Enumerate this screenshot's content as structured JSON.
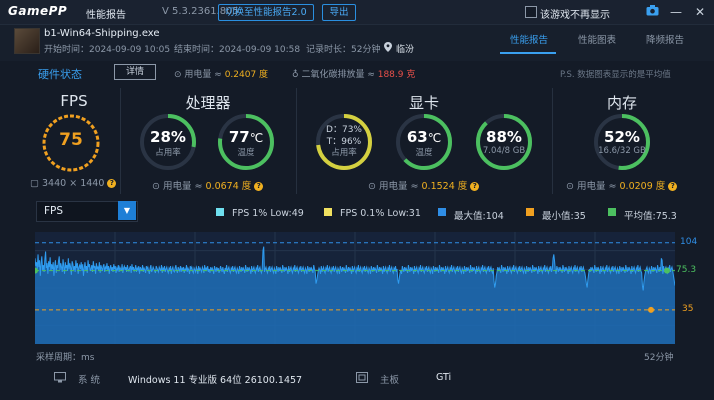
{
  "titlebar": {
    "logo": "GamePP",
    "title": "性能报告",
    "version": "V 5.3.2361.805",
    "switch_btn": "切换至性能报告2.0",
    "export_btn": "导出",
    "no_show_label": "该游戏不再显示"
  },
  "game": {
    "exe": "b1-Win64-Shipping.exe",
    "start": "开始时间：2024-09-09 10:05",
    "end": "结束时间：2024-09-09 10:58",
    "duration": "记录时长：52分钟",
    "location": "临汾"
  },
  "tabs": [
    {
      "label": "性能报告",
      "active": true
    },
    {
      "label": "性能图表",
      "active": false
    },
    {
      "label": "降频报告",
      "active": false
    }
  ],
  "status_row": {
    "title": "硬件状态",
    "detail_btn": "详情",
    "power_label": "用电量 ≈ ",
    "power_value": "0.2407 度",
    "co2_label": "二氧化碳排放量 ≈ ",
    "co2_value": "188.9 克",
    "ps": "P.S. 数据图表显示的是平均值"
  },
  "cards": {
    "fps": {
      "title": "FPS",
      "value": "75",
      "resolution": "3440 × 1440"
    },
    "cpu": {
      "title": "处理器",
      "usage": "28%",
      "usage_label": "占用率",
      "usage_pct": 28,
      "temp": "77",
      "temp_unit": "℃",
      "temp_label": "温度",
      "temp_pct": 77,
      "power_label": "用电量 ≈ ",
      "power_value": "0.0674 度"
    },
    "gpu": {
      "title": "显卡",
      "d_line": "D：73%",
      "t_line": "T：96%",
      "usage_label": "占用率",
      "usage_pct": 73,
      "temp": "63",
      "temp_unit": "℃",
      "temp_label": "温度",
      "temp_pct": 63,
      "vram": "88%",
      "vram_sub": "7.04/8 GB",
      "vram_pct": 88,
      "power_label": "用电量 ≈ ",
      "power_value": "0.1524 度"
    },
    "mem": {
      "title": "内存",
      "usage": "52%",
      "usage_sub": "16.6/32 GB",
      "usage_pct": 52,
      "power_label": "用电量 ≈ ",
      "power_value": "0.0209 度"
    }
  },
  "chart_controls": {
    "select_value": "FPS",
    "legend": [
      {
        "label": "FPS 1% Low:49",
        "color": "#6fe0f0"
      },
      {
        "label": "FPS 0.1% Low:31",
        "color": "#f0e060"
      },
      {
        "label": "最大值:104",
        "color": "#2f8ee6"
      },
      {
        "label": "最小值:35",
        "color": "#f0a020"
      },
      {
        "label": "平均值:75.3",
        "color": "#4cc060"
      }
    ]
  },
  "chart_data": {
    "type": "area",
    "series": [
      {
        "values": [
          88,
          80,
          84,
          77,
          92,
          79,
          86,
          70,
          83,
          90,
          76,
          81,
          74,
          87,
          95,
          78,
          83,
          72,
          85,
          79,
          89,
          75,
          82,
          77,
          84,
          70,
          80,
          86,
          73,
          81,
          78,
          85,
          90,
          76,
          83,
          79,
          74,
          87,
          80,
          72,
          84,
          78,
          81,
          75,
          88,
          77,
          83,
          79,
          71,
          85,
          82,
          76,
          80,
          74,
          86,
          78,
          83,
          72,
          79,
          81,
          77,
          84,
          75,
          82,
          70,
          78,
          84,
          76,
          80,
          73,
          86,
          79,
          82,
          75,
          77,
          81,
          74,
          85,
          78,
          80,
          72,
          83,
          77,
          79,
          76,
          84,
          73,
          81,
          78,
          75,
          80,
          82,
          74,
          79,
          77,
          83,
          76,
          80,
          72,
          78,
          81,
          75,
          79,
          74,
          82,
          77,
          80,
          73,
          78,
          76,
          81,
          74,
          79,
          77,
          75,
          82,
          73,
          78,
          80,
          76,
          79,
          74,
          81,
          77,
          75,
          78,
          80,
          73,
          82,
          76,
          79,
          75,
          77,
          81,
          74,
          78,
          76,
          80,
          72,
          79,
          77,
          75,
          81,
          74,
          78,
          76,
          73,
          80,
          77,
          79,
          75,
          72,
          78,
          81,
          74,
          76,
          79,
          77,
          75,
          73,
          80,
          78,
          76,
          74,
          79,
          77,
          75,
          81,
          73,
          78,
          76,
          80,
          74,
          77,
          79,
          75,
          73,
          78,
          76,
          80,
          72,
          77,
          79,
          75,
          74,
          78,
          81,
          76,
          73,
          79,
          77,
          75,
          80,
          74,
          78,
          76,
          79,
          73,
          77,
          75,
          81,
          74,
          78,
          76,
          72,
          80,
          77,
          79,
          75,
          73,
          78,
          76,
          74,
          79,
          77,
          72,
          80,
          75,
          78,
          76,
          74,
          79,
          77,
          73,
          81,
          75,
          78,
          76,
          80,
          74,
          77,
          73,
          79,
          75,
          78,
          76,
          72,
          80,
          77,
          74,
          79,
          75,
          78,
          73,
          76,
          80,
          77,
          74,
          79,
          75,
          72,
          78,
          76,
          81,
          74,
          77,
          79,
          75,
          73,
          78,
          76,
          80,
          74,
          77,
          79,
          75,
          73,
          78,
          76,
          72,
          80,
          77,
          74,
          79,
          75,
          78,
          76,
          73,
          81,
          77,
          74,
          79,
          75,
          78,
          76,
          72,
          80,
          74,
          77,
          79,
          75,
          73,
          78,
          76,
          81,
          74,
          77,
          79,
          75,
          73,
          78,
          96,
          100,
          74,
          77,
          79,
          75,
          73,
          78,
          76,
          80,
          74,
          77,
          79,
          75,
          73,
          78,
          76,
          72,
          80,
          77,
          74,
          79,
          75,
          78,
          76,
          73,
          81,
          77,
          74,
          79,
          75,
          78,
          76,
          72,
          80,
          74,
          77,
          79,
          75,
          73,
          78,
          76,
          81,
          74,
          77,
          79,
          75,
          73,
          78,
          76,
          80,
          74,
          77,
          79,
          75,
          73,
          78,
          76,
          72,
          80,
          77,
          74,
          79,
          75,
          78,
          76,
          73,
          81,
          77,
          74,
          62,
          65,
          70,
          75,
          78,
          76,
          72,
          80,
          74,
          77,
          79,
          75,
          73,
          78,
          76,
          81,
          74,
          77,
          79,
          75,
          73,
          78,
          76,
          80,
          74,
          77,
          79,
          75,
          73,
          78,
          76,
          72,
          80,
          77,
          74,
          79,
          75,
          78,
          76,
          73,
          81,
          77,
          74,
          79,
          75,
          78,
          76,
          72,
          80,
          74,
          77,
          79,
          75,
          73,
          78,
          76,
          81,
          74,
          77,
          79,
          75,
          73,
          78,
          76,
          80,
          74,
          77,
          79,
          75,
          73,
          78,
          76,
          72,
          80,
          77,
          74,
          79,
          75,
          78,
          76,
          73,
          81,
          77,
          74,
          79,
          75,
          78,
          76,
          72,
          80,
          74,
          77,
          79,
          75,
          73,
          78,
          76,
          81,
          74,
          77,
          79,
          75,
          73,
          78,
          76,
          80,
          74,
          77,
          66,
          62,
          68,
          73,
          76,
          72,
          80,
          77,
          74,
          79,
          75,
          78,
          76,
          73,
          81,
          77,
          74,
          79,
          75,
          78,
          76,
          72,
          80,
          74,
          77,
          79,
          75,
          73,
          78,
          76,
          81,
          74,
          77,
          79,
          75,
          73,
          78,
          76,
          80,
          74,
          77,
          79,
          75,
          73,
          78,
          76,
          72,
          80,
          77,
          74,
          79,
          75,
          78,
          76,
          73,
          81,
          77,
          74,
          79,
          75,
          78,
          76,
          72,
          80,
          74,
          77,
          79,
          75,
          73,
          78,
          76,
          81,
          74,
          77,
          79,
          75,
          73,
          78,
          76,
          80,
          74,
          77,
          79,
          75,
          73,
          78,
          76,
          72,
          80,
          77,
          74,
          79,
          75,
          78,
          76,
          73,
          81,
          77,
          74,
          79,
          75,
          78,
          76,
          72,
          80,
          74,
          77,
          79,
          75,
          73,
          78,
          76,
          81,
          74,
          77,
          79,
          75,
          73,
          78,
          76,
          80,
          74,
          77,
          79,
          75,
          73,
          78,
          65,
          58,
          62,
          70,
          74,
          79,
          75,
          78,
          76,
          73,
          81,
          77,
          74,
          79,
          75,
          78,
          76,
          72,
          80,
          74,
          77,
          79,
          75,
          73,
          78,
          76,
          81,
          74,
          77,
          79,
          75,
          73,
          78,
          76,
          80,
          74,
          77,
          79,
          75,
          73,
          78,
          76,
          72,
          80,
          77,
          74,
          79,
          75,
          78,
          76,
          73,
          81,
          77,
          74,
          79,
          75,
          78,
          76,
          72,
          80,
          74,
          77,
          79,
          75,
          73,
          78,
          76,
          81,
          74,
          77,
          79,
          75,
          73,
          78,
          76,
          80,
          74,
          77,
          88,
          92,
          85,
          76,
          72,
          80,
          77,
          74,
          79,
          75,
          78,
          76,
          73,
          81,
          77,
          74,
          79,
          75,
          78,
          76,
          72,
          80,
          74,
          77,
          79,
          75,
          73,
          78,
          76,
          81,
          74,
          77,
          79,
          75,
          73,
          78,
          76,
          80,
          74,
          77,
          79,
          75,
          73,
          68,
          62,
          58,
          66,
          72,
          77,
          74,
          79,
          75,
          78,
          76,
          73,
          81,
          77,
          74,
          79,
          75,
          78,
          76,
          72,
          80,
          74,
          77,
          79,
          75,
          73,
          78,
          76,
          81,
          74,
          77,
          79,
          75,
          73,
          78,
          76,
          80,
          74,
          77,
          79,
          75,
          73,
          78,
          76,
          72,
          80,
          77,
          74,
          79,
          75,
          78,
          76,
          73,
          81,
          77,
          74,
          79,
          75,
          78,
          76,
          72,
          80,
          74,
          77,
          79,
          75,
          73,
          78,
          76,
          81,
          74,
          77,
          79,
          75,
          73,
          60,
          55,
          64,
          70,
          74,
          77,
          79,
          75,
          73,
          78,
          76,
          72,
          80,
          77,
          74,
          79,
          75,
          78,
          76,
          73,
          81,
          77,
          74,
          79,
          75,
          88,
          86,
          72,
          80,
          74,
          77,
          79,
          75,
          73,
          78,
          76,
          81,
          74,
          77,
          79,
          75,
          70,
          65,
          60
        ]
      }
    ],
    "ylim": [
      0,
      115
    ],
    "max": 104,
    "min": 35,
    "avg": 75.3,
    "labels": {
      "max": "104",
      "avg": "75.3",
      "min": "35"
    }
  },
  "chart_footer": {
    "left": "采样周期：ms",
    "right": "52分钟"
  },
  "system": [
    {
      "key": "系  统",
      "value": "Windows 11 专业版 64位 26100.1457",
      "icon": "monitor-icon"
    },
    {
      "key": "主板",
      "value": "GTi",
      "icon": "board-icon"
    }
  ],
  "colors": {
    "accent": "#3aa0f0",
    "bg": "#141b27",
    "ring_green": "#4cc060",
    "ring_orange": "#f0a020",
    "ring_yellow": "#d4d040"
  }
}
